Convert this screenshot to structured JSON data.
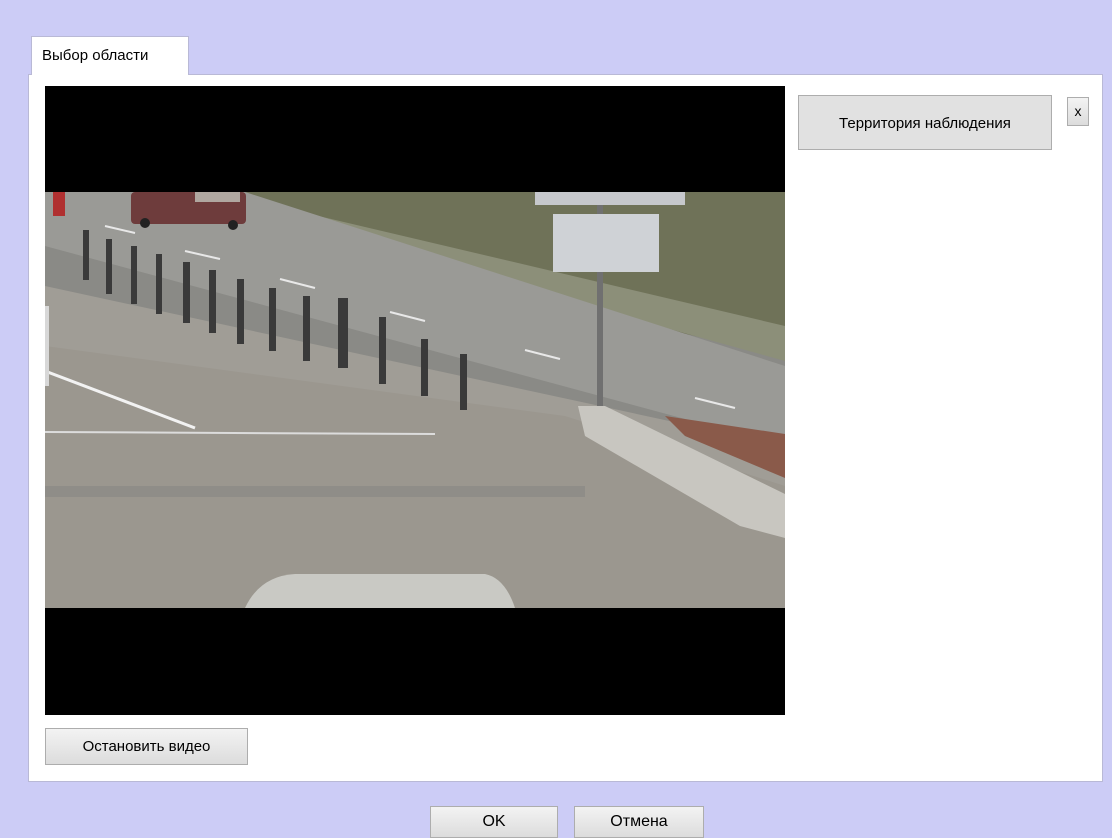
{
  "tab": {
    "label": "Выбор области"
  },
  "territory_button": {
    "label": "Территория наблюдения"
  },
  "close_button": {
    "label": "x"
  },
  "stop_video_button": {
    "label": "Остановить видео"
  },
  "ok_button": {
    "label": "OK"
  },
  "cancel_button": {
    "label": "Отмена"
  },
  "colors": {
    "window_background": "#ccccf6",
    "panel_background": "#ffffff",
    "video_letterbox": "#000000"
  }
}
